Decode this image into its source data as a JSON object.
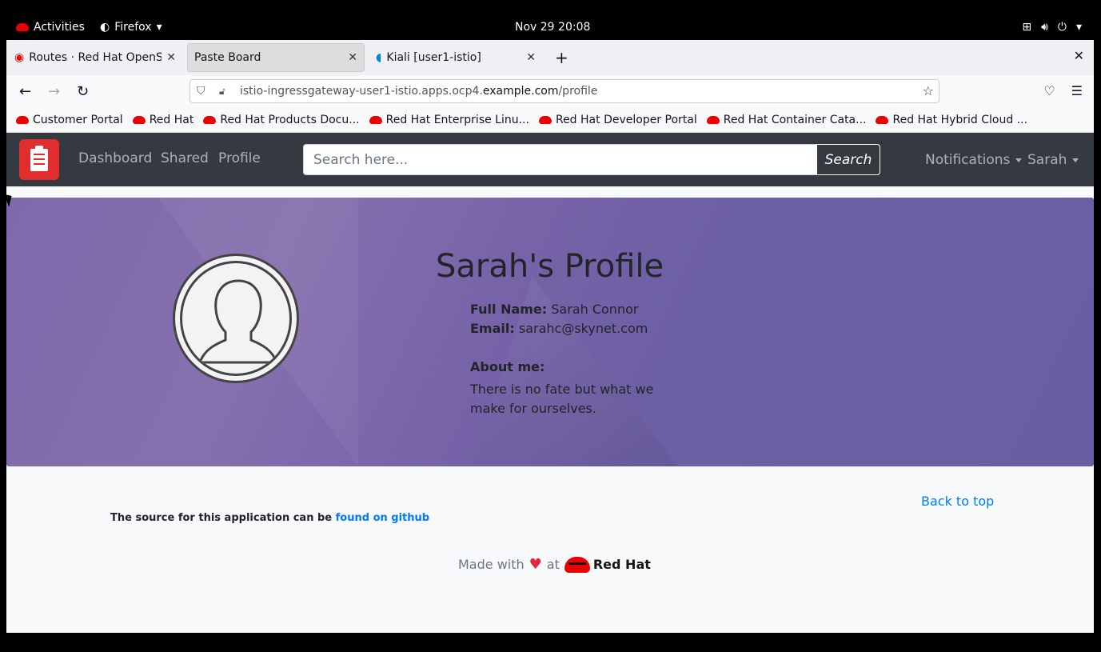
{
  "gnome": {
    "activities": "Activities",
    "app_name": "Firefox",
    "clock": "Nov 29  20:08"
  },
  "tabs": [
    {
      "label": "Routes · Red Hat OpenShi",
      "active": false
    },
    {
      "label": "Paste Board",
      "active": true
    },
    {
      "label": "Kiali [user1-istio]",
      "active": false
    }
  ],
  "urlbar": {
    "prefix": "istio-ingressgateway-user1-istio.apps.ocp4.",
    "domain": "example.com",
    "path": "/profile"
  },
  "bookmarks": [
    "Customer Portal",
    "Red Hat",
    "Red Hat Products Docu...",
    "Red Hat Enterprise Linu...",
    "Red Hat Developer Portal",
    "Red Hat Container Cata...",
    "Red Hat Hybrid Cloud ..."
  ],
  "app_nav": {
    "links": [
      "Dashboard",
      "Shared",
      "Profile"
    ],
    "search_placeholder": "Search here...",
    "search_button": "Search",
    "notifications": "Notifications",
    "user": "Sarah"
  },
  "profile": {
    "title": "Sarah's Profile",
    "full_name_label": "Full Name:",
    "full_name": "Sarah Connor",
    "email_label": "Email:",
    "email": "sarahc@skynet.com",
    "about_label": "About me:",
    "about": "There is no fate but what we make for ourselves."
  },
  "footer": {
    "back_to_top": "Back to top",
    "source_text": "The source for this application can be ",
    "source_link": "found on github",
    "made_with": "Made with",
    "at": "at",
    "brand": "Red Hat"
  },
  "colors": {
    "nav_bg": "#343a40",
    "hero_bg": "#7664a8",
    "link": "#007bff",
    "logo_red": "#e02d2d"
  }
}
